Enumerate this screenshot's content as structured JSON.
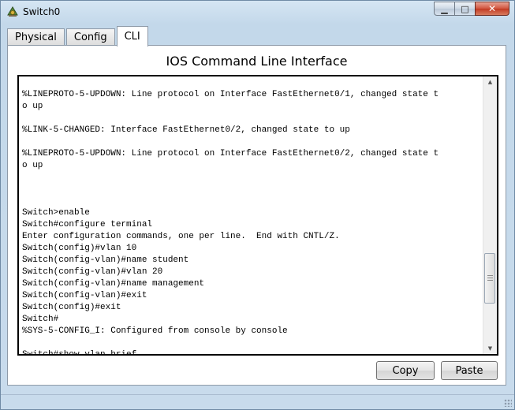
{
  "window": {
    "title": "Switch0",
    "caption": {
      "minimize": "▁",
      "maximize": "□",
      "close": "✕"
    }
  },
  "tabs": [
    {
      "label": "Physical",
      "active": false
    },
    {
      "label": "Config",
      "active": false
    },
    {
      "label": "CLI",
      "active": true
    }
  ],
  "panel": {
    "title": "IOS Command Line Interface"
  },
  "console": {
    "lines": [
      "",
      "%LINEPROTO-5-UPDOWN: Line protocol on Interface FastEthernet0/1, changed state t",
      "o up",
      "",
      "%LINK-5-CHANGED: Interface FastEthernet0/2, changed state to up",
      "",
      "%LINEPROTO-5-UPDOWN: Line protocol on Interface FastEthernet0/2, changed state t",
      "o up",
      "",
      "",
      "",
      "Switch>enable",
      "Switch#configure terminal",
      "Enter configuration commands, one per line.  End with CNTL/Z.",
      "Switch(config)#vlan 10",
      "Switch(config-vlan)#name student",
      "Switch(config-vlan)#vlan 20",
      "Switch(config-vlan)#name management",
      "Switch(config-vlan)#exit",
      "Switch(config)#exit",
      "Switch#",
      "%SYS-5-CONFIG_I: Configured from console by console",
      "",
      "Switch#show vlan brief"
    ]
  },
  "scroll": {
    "up_arrow": "▲",
    "down_arrow": "▼"
  },
  "buttons": {
    "copy_label": "Copy",
    "paste_label": "Paste"
  },
  "colors": {
    "close_button": "#c23a22",
    "panel_background": "#ffffff",
    "console_text": "#000000"
  }
}
